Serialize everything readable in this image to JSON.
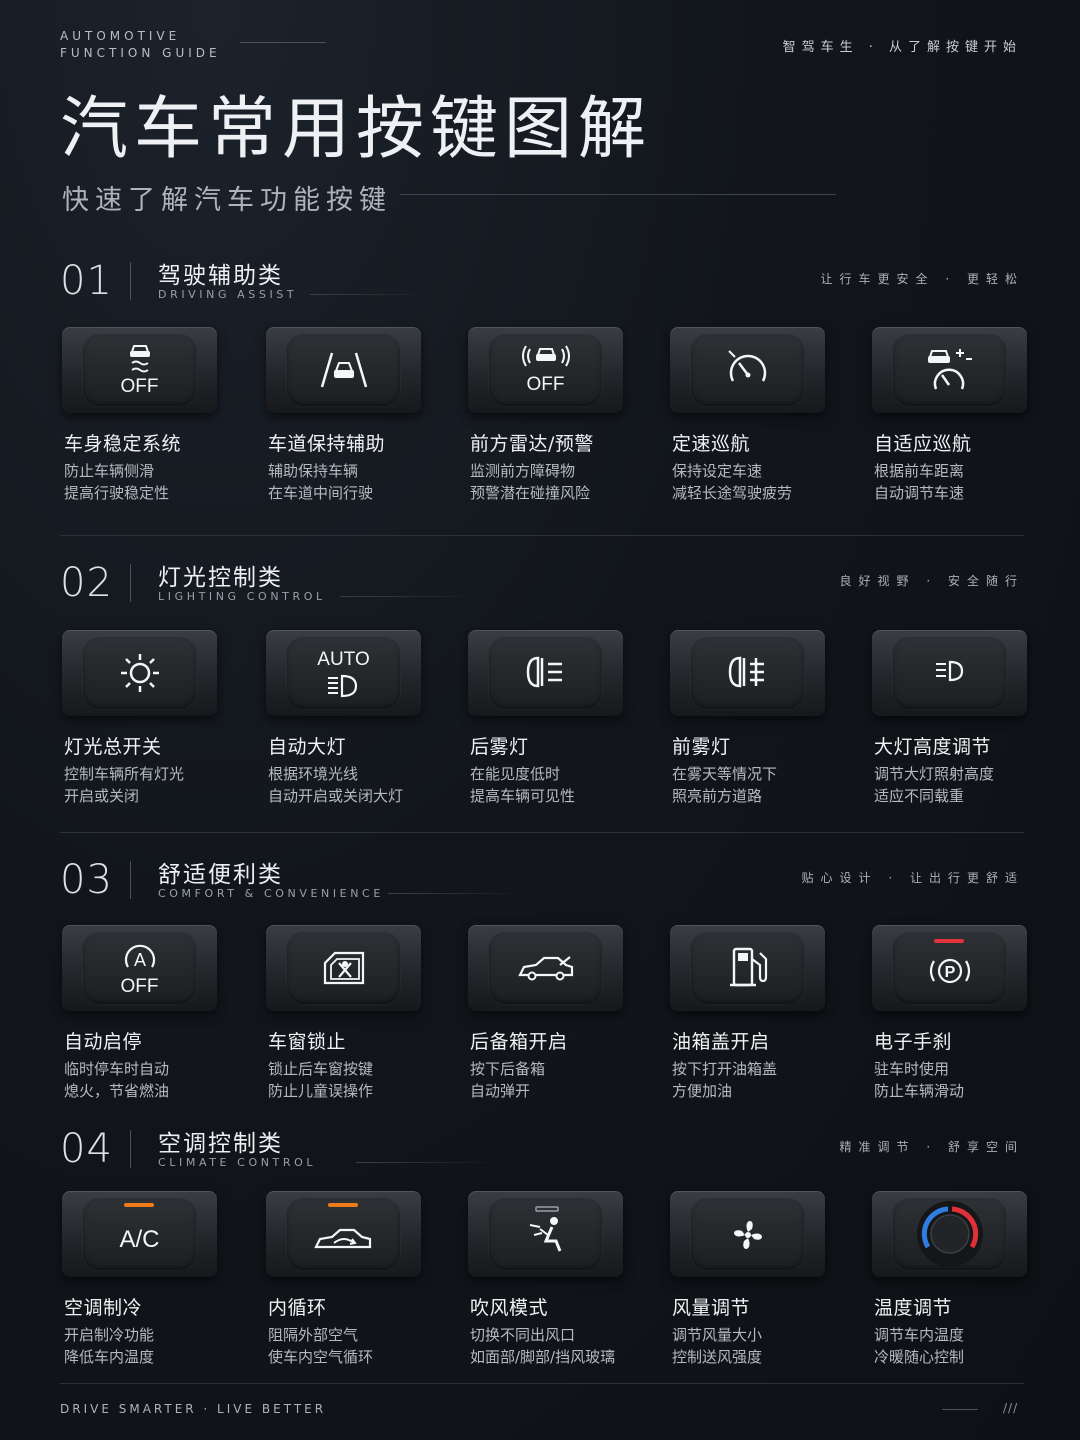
{
  "header": {
    "brand_line1": "AUTOMOTIVE",
    "brand_line2": "FUNCTION GUIDE",
    "tagline": "智驾车生 · 从了解按键开始",
    "title": "汽车常用按键图解",
    "subtitle": "快速了解汽车功能按键"
  },
  "sections": [
    {
      "num": "01",
      "title": "驾驶辅助类",
      "en": "DRIVING ASSIST",
      "tag": "让行车更安全 · 更轻松",
      "items": [
        {
          "title": "车身稳定系统",
          "desc1": "防止车辆侧滑",
          "desc2": "提高行驶稳定性",
          "icon": "esp-off-icon",
          "glyph_text": "OFF"
        },
        {
          "title": "车道保持辅助",
          "desc1": "辅助保持车辆",
          "desc2": "在车道中间行驶",
          "icon": "lane-keep-icon"
        },
        {
          "title": "前方雷达/预警",
          "desc1": "监测前方障碍物",
          "desc2": "预警潜在碰撞风险",
          "icon": "radar-off-icon",
          "glyph_text": "OFF"
        },
        {
          "title": "定速巡航",
          "desc1": "保持设定车速",
          "desc2": "减轻长途驾驶疲劳",
          "icon": "cruise-icon"
        },
        {
          "title": "自适应巡航",
          "desc1": "根据前车距离",
          "desc2": "自动调节车速",
          "icon": "adaptive-cruise-icon"
        }
      ]
    },
    {
      "num": "02",
      "title": "灯光控制类",
      "en": "LIGHTING CONTROL",
      "tag": "良好视野 · 安全随行",
      "items": [
        {
          "title": "灯光总开关",
          "desc1": "控制车辆所有灯光",
          "desc2": "开启或关闭",
          "icon": "light-switch-icon"
        },
        {
          "title": "自动大灯",
          "desc1": "根据环境光线",
          "desc2": "自动开启或关闭大灯",
          "icon": "auto-headlight-icon",
          "glyph_text": "AUTO"
        },
        {
          "title": "后雾灯",
          "desc1": "在能见度低时",
          "desc2": "提高车辆可见性",
          "icon": "rear-fog-icon"
        },
        {
          "title": "前雾灯",
          "desc1": "在雾天等情况下",
          "desc2": "照亮前方道路",
          "icon": "front-fog-icon"
        },
        {
          "title": "大灯高度调节",
          "desc1": "调节大灯照射高度",
          "desc2": "适应不同载重",
          "icon": "headlight-level-icon"
        }
      ]
    },
    {
      "num": "03",
      "title": "舒适便利类",
      "en": "COMFORT & CONVENIENCE",
      "tag": "贴心设计 · 让出行更舒适",
      "items": [
        {
          "title": "自动启停",
          "desc1": "临时停车时自动",
          "desc2": "熄火，节省燃油",
          "icon": "auto-stop-start-icon",
          "glyph_text": "OFF"
        },
        {
          "title": "车窗锁止",
          "desc1": "锁止后车窗按键",
          "desc2": "防止儿童误操作",
          "icon": "window-lock-icon"
        },
        {
          "title": "后备箱开启",
          "desc1": "按下后备箱",
          "desc2": "自动弹开",
          "icon": "trunk-open-icon"
        },
        {
          "title": "油箱盖开启",
          "desc1": "按下打开油箱盖",
          "desc2": "方便加油",
          "icon": "fuel-door-icon"
        },
        {
          "title": "电子手刹",
          "desc1": "驻车时使用",
          "desc2": "防止车辆滑动",
          "icon": "parking-brake-icon",
          "indicator_color": "#e2323a"
        }
      ]
    },
    {
      "num": "04",
      "title": "空调控制类",
      "en": "CLIMATE CONTROL",
      "tag": "精准调节 · 舒享空间",
      "items": [
        {
          "title": "空调制冷",
          "desc1": "开启制冷功能",
          "desc2": "降低车内温度",
          "icon": "ac-icon",
          "glyph_text": "A/C",
          "indicator_color": "#ef7a1a"
        },
        {
          "title": "内循环",
          "desc1": "阻隔外部空气",
          "desc2": "使车内空气循环",
          "icon": "recirculation-icon",
          "indicator_color": "#ef7a1a"
        },
        {
          "title": "吹风模式",
          "desc1": "切换不同出风口",
          "desc2": "如面部/脚部/挡风玻璃",
          "icon": "airflow-mode-icon"
        },
        {
          "title": "风量调节",
          "desc1": "调节风量大小",
          "desc2": "控制送风强度",
          "icon": "fan-speed-icon"
        },
        {
          "title": "温度调节",
          "desc1": "调节车内温度",
          "desc2": "冷暖随心控制",
          "icon": "temperature-knob-icon"
        }
      ]
    }
  ],
  "footer": {
    "text": "DRIVE SMARTER · LIVE BETTER",
    "mark": "///"
  },
  "colors": {
    "background": "#12161c",
    "indicator_orange": "#ef7a1a",
    "indicator_red": "#e2323a",
    "knob_blue": "#2f7de0",
    "knob_red": "#e0303a"
  }
}
